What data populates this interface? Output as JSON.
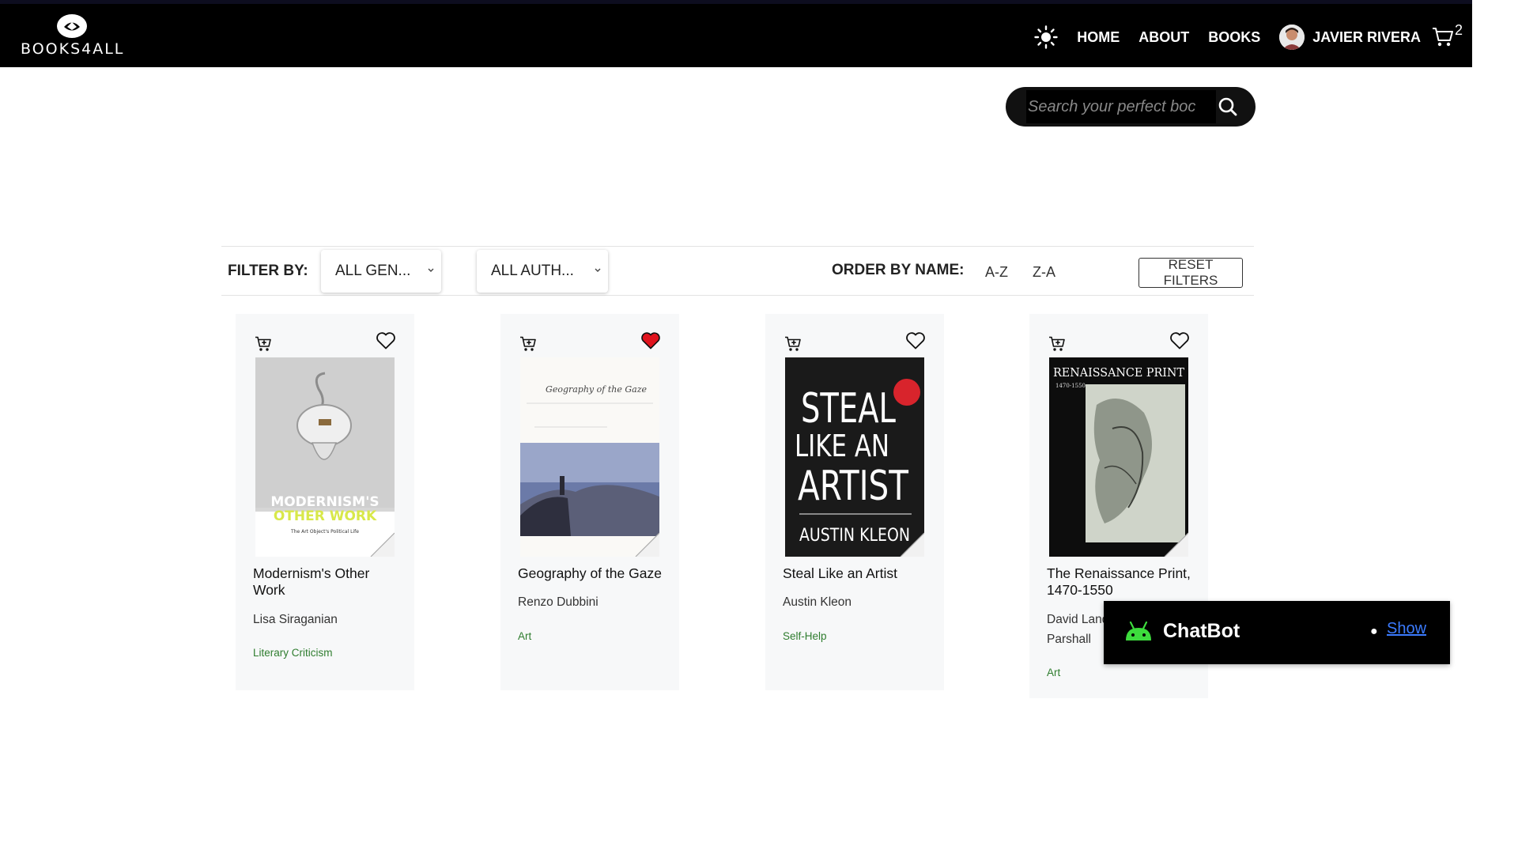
{
  "brand": {
    "name": "BOOKS4ALL",
    "logo_icon": "book-eye-logo"
  },
  "nav": {
    "theme_icon": "sun-icon",
    "links": [
      "HOME",
      "ABOUT",
      "BOOKS"
    ],
    "user_name": "JAVIER RIVERA",
    "cart_icon": "cart-icon",
    "cart_count": "2"
  },
  "search": {
    "placeholder": "Search your perfect boc",
    "icon": "search-icon"
  },
  "filters": {
    "label": "FILTER BY:",
    "genre_select": "ALL GEN...",
    "author_select": "ALL AUTH...",
    "order_label": "ORDER BY NAME:",
    "order_options": [
      "A-Z",
      "Z-A"
    ],
    "reset_label": "RESET FILTERS"
  },
  "books": [
    {
      "title": "Modernism's Other Work",
      "author": "Lisa Siraganian",
      "genre": "Literary Criticism",
      "favorite": false,
      "cover_text": [
        "MODERNISM'S",
        "OTHER WORK",
        "The Art Object's Political Life"
      ]
    },
    {
      "title": "Geography of the Gaze",
      "author": "Renzo Dubbini",
      "genre": "Art",
      "favorite": true,
      "cover_text": [
        "Geography of the Gaze"
      ]
    },
    {
      "title": "Steal Like an Artist",
      "author": "Austin Kleon",
      "genre": "Self-Help",
      "favorite": false,
      "cover_text": [
        "STEAL",
        "LIKE AN",
        "ARTIST",
        "AUSTIN KLEON"
      ]
    },
    {
      "title": "The Renaissance Print, 1470-1550",
      "author": "David Landau, Peter Parshall",
      "author_visible_lines": [
        "David Land",
        "Parshall"
      ],
      "genre": "Art",
      "favorite": false,
      "cover_text": [
        "RENAISSANCE PRINT",
        "1470-1550"
      ]
    }
  ],
  "chatbot": {
    "title": "ChatBot",
    "toggle_label": "Show",
    "icon": "android-icon"
  },
  "colors": {
    "navbar": "#000000",
    "favorite_active": "#e0141e",
    "genre_text": "#2f7d2f",
    "chatbot_bg": "#000000",
    "link": "#3b7bff"
  }
}
